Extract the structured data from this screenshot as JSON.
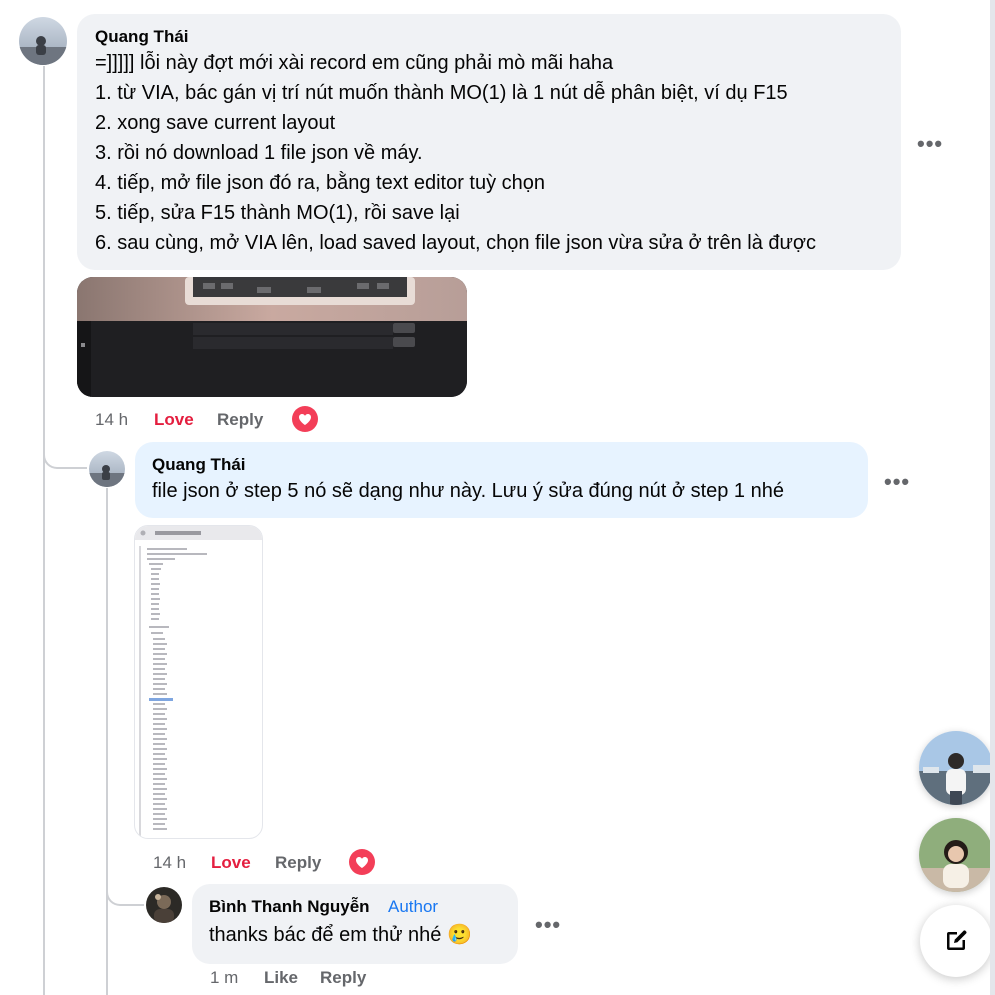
{
  "comments": [
    {
      "author": "Quang Thái",
      "lines": [
        "=]]]]] lỗi này đợt mới xài record em cũng phải mò mãi haha",
        "1. từ VIA, bác gán vị trí nút muốn thành MO(1) là 1 nút dễ phân biệt, ví dụ F15",
        "2. xong save current layout",
        "3. rồi nó download 1 file json về máy.",
        "4. tiếp, mở file json đó ra, bằng text editor tuỳ chọn",
        "5. tiếp, sửa F15 thành MO(1), rồi save lại",
        "6. sau cùng, mở VIA lên, load saved layout, chọn file json vừa sửa ở trên là được"
      ],
      "time": "14 h",
      "love_label": "Love",
      "reply_label": "Reply",
      "more": "•••"
    },
    {
      "author": "Quang Thái",
      "lines": [
        "file json ở step 5 nó sẽ dạng như này. Lưu ý sửa đúng nút ở step 1 nhé"
      ],
      "time": "14 h",
      "love_label": "Love",
      "reply_label": "Reply",
      "more": "•••"
    },
    {
      "author": "Bình Thanh Nguyễn",
      "badge": "Author",
      "lines": [
        "thanks bác để em thử nhé"
      ],
      "emoji": "🥲",
      "time": "1 m",
      "like_label": "Like",
      "reply_label": "Reply",
      "more": "•••"
    }
  ],
  "colors": {
    "bubble_gray": "#f0f2f5",
    "bubble_blue": "#e7f3ff",
    "love_red": "#e41e3f",
    "author_badge": "#1877f2",
    "meta_gray": "#65676b"
  }
}
